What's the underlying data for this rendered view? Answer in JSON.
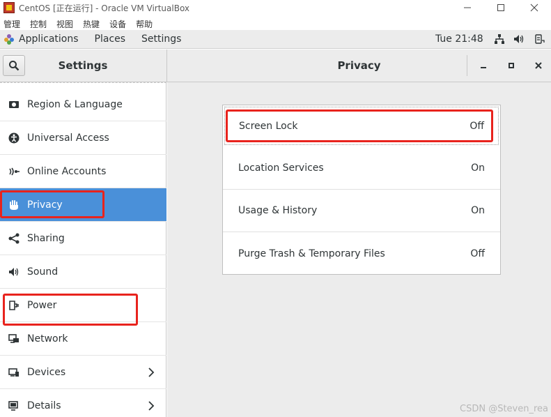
{
  "vbox": {
    "title": "CentOS [正在运行] - Oracle VM VirtualBox",
    "menu": [
      "管理",
      "控制",
      "视图",
      "热键",
      "设备",
      "帮助"
    ]
  },
  "gnome": {
    "applications": "Applications",
    "places": "Places",
    "settings": "Settings",
    "clock": "Tue 21:48"
  },
  "header": {
    "settings_title": "Settings",
    "panel_title": "Privacy"
  },
  "sidebar": {
    "items": [
      {
        "label": "Region & Language",
        "icon": "region-icon"
      },
      {
        "label": "Universal Access",
        "icon": "accessibility-icon"
      },
      {
        "label": "Online Accounts",
        "icon": "online-accounts-icon"
      },
      {
        "label": "Privacy",
        "icon": "hand-icon",
        "selected": true
      },
      {
        "label": "Sharing",
        "icon": "share-icon"
      },
      {
        "label": "Sound",
        "icon": "speaker-icon"
      },
      {
        "label": "Power",
        "icon": "power-plug-icon"
      },
      {
        "label": "Network",
        "icon": "network-icon"
      },
      {
        "label": "Devices",
        "icon": "devices-icon",
        "chevron": true
      },
      {
        "label": "Details",
        "icon": "details-icon",
        "chevron": true
      }
    ]
  },
  "privacy": {
    "rows": [
      {
        "label": "Screen Lock",
        "value": "Off"
      },
      {
        "label": "Location Services",
        "value": "On"
      },
      {
        "label": "Usage & History",
        "value": "On"
      },
      {
        "label": "Purge Trash & Temporary Files",
        "value": "Off"
      }
    ]
  },
  "colors": {
    "selected_bg": "#4a90d9",
    "annotation": "#e8231d"
  },
  "watermark": "CSDN @Steven_rea"
}
